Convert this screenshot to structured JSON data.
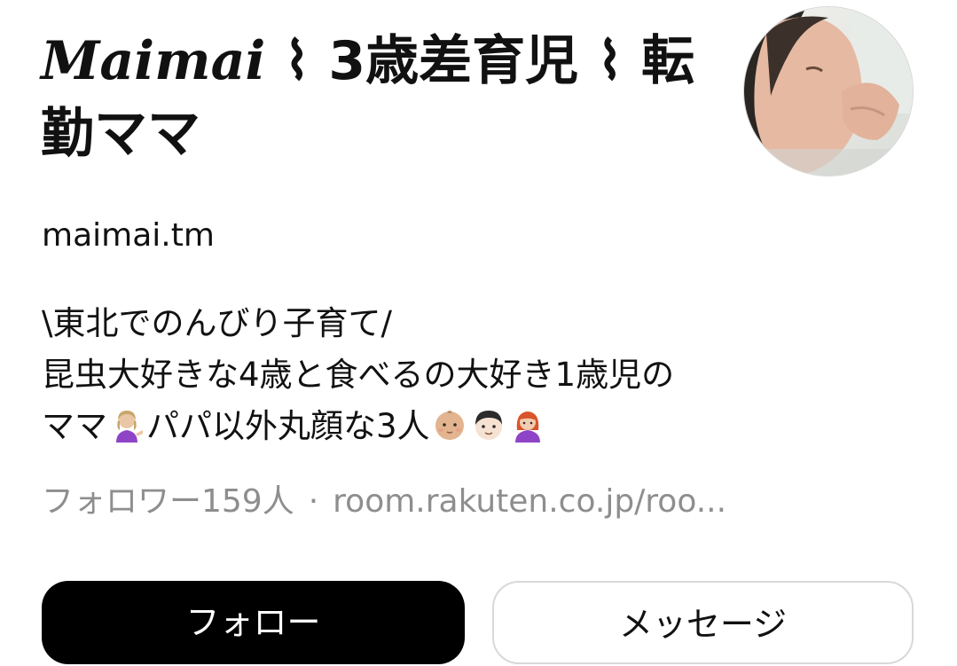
{
  "profile": {
    "display_name_latin": "Maimai",
    "display_name_rest": " ⌇ 3歳差育児 ⌇ 転勤ママ",
    "username": "maimai.tm",
    "bio": {
      "line1": "\\東北でのんびり子育て/",
      "line2": "昆虫大好きな4歳と食べるの大好き1歳児の",
      "line3_a": "ママ",
      "line3_b": "パパ以外丸顔な3人"
    },
    "followers": "フォロワー159人",
    "separator": "·",
    "link": "room.rakuten.co.jp/roo..."
  },
  "actions": {
    "follow_label": "フォロー",
    "message_label": "メッセージ"
  },
  "icons": {
    "avatar": "baby-photo-avatar",
    "emoji_1": "woman-tipping-hand-emoji",
    "emoji_2": "baby-emoji",
    "emoji_3": "boy-emoji",
    "emoji_4": "woman-red-hair-emoji"
  },
  "colors": {
    "follow_bg": "#000000",
    "follow_text": "#ffffff",
    "muted_text": "#8e8e8e",
    "border": "#d8d8d8"
  }
}
